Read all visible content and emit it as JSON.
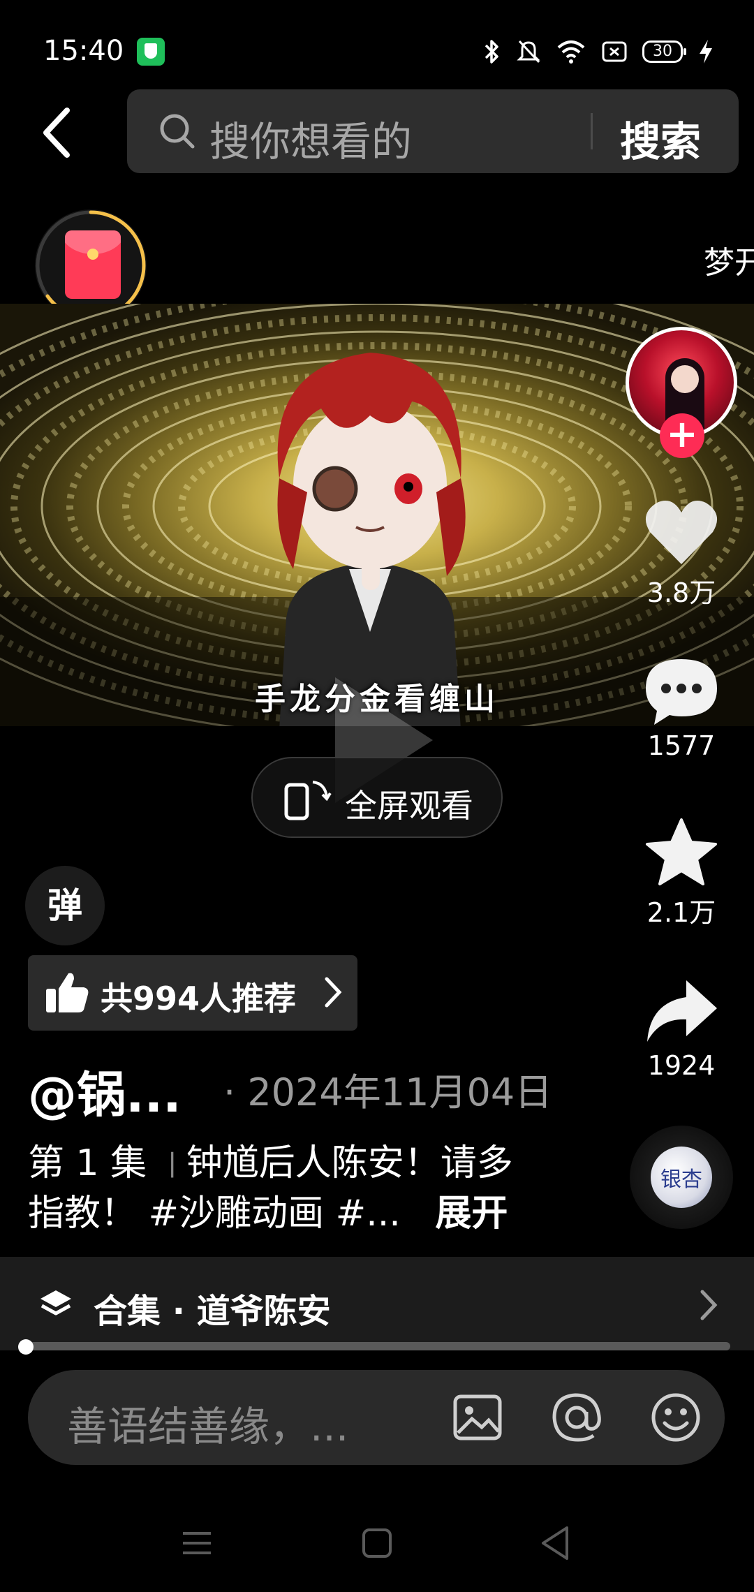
{
  "status_bar": {
    "time": "15:40",
    "battery": "30",
    "icons": [
      "shield-app-icon",
      "bluetooth-icon",
      "mute-icon",
      "wifi-icon",
      "nfc-icon",
      "battery-icon",
      "charging-icon"
    ]
  },
  "search": {
    "placeholder": "搜你想看的",
    "button": "搜索"
  },
  "top_marquee": "梦开",
  "video": {
    "subtitle": "手龙分金看缠山",
    "fullscreen_label": "全屏观看"
  },
  "right_rail": {
    "likes": "3.8万",
    "comments": "1577",
    "favorites": "2.1万",
    "shares": "1924",
    "music_disc_text": "银杏"
  },
  "danmaku_label": "弹",
  "recommend": {
    "label": "共994人推荐"
  },
  "post": {
    "author": "@锅...",
    "date": "· 2024年11月04日",
    "desc_line1_a": "第 1 集",
    "desc_sep": "丨",
    "desc_line1_b": "钟馗后人陈安！请多",
    "desc_line2": "指教！ #沙雕动画 #...",
    "expand": "展开"
  },
  "collection": {
    "label": "合集 · 道爷陈安"
  },
  "progress": {
    "fraction": 0.0
  },
  "comment": {
    "placeholder": "善语结善缘，..."
  },
  "colors": {
    "accent_red": "#fe2c55",
    "gold_ring": "#f5c04a",
    "background": "#000000"
  }
}
